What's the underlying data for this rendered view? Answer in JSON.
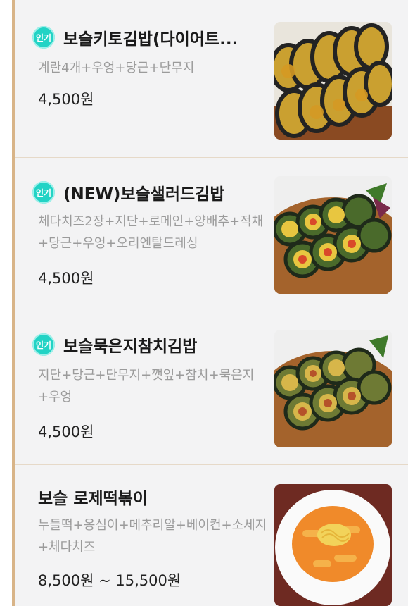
{
  "menu": {
    "items": [
      {
        "badge": "인기",
        "name": "보슬키토김밥(다이어트...",
        "description": "계란4개+우엉+당근+단무지",
        "price": "4,500원",
        "photo": "keto-gimbap-photo"
      },
      {
        "badge": "인기",
        "name": "(NEW)보슬샐러드김밥",
        "description": "체다치즈2장+지단+로메인+양배추+적채+당근+우엉+오리엔탈드레싱",
        "price": "4,500원",
        "photo": "salad-gimbap-photo"
      },
      {
        "badge": "인기",
        "name": "보슬묵은지참치김밥",
        "description": "지단+당근+단무지+깻잎+참치+묵은지+우엉",
        "price": "4,500원",
        "photo": "kimchi-tuna-gimbap-photo"
      },
      {
        "name": "보슬 로제떡볶이",
        "description": "누들떡+옹심이+메추리알+베이컨+소세지+체다치즈",
        "price": "8,500원 ~ 15,500원",
        "photo": "rose-tteokbokki-photo"
      }
    ]
  },
  "colors": {
    "badge": "#22d3c5",
    "accent_bar": "#d8b488",
    "background": "#f3f3f4"
  }
}
